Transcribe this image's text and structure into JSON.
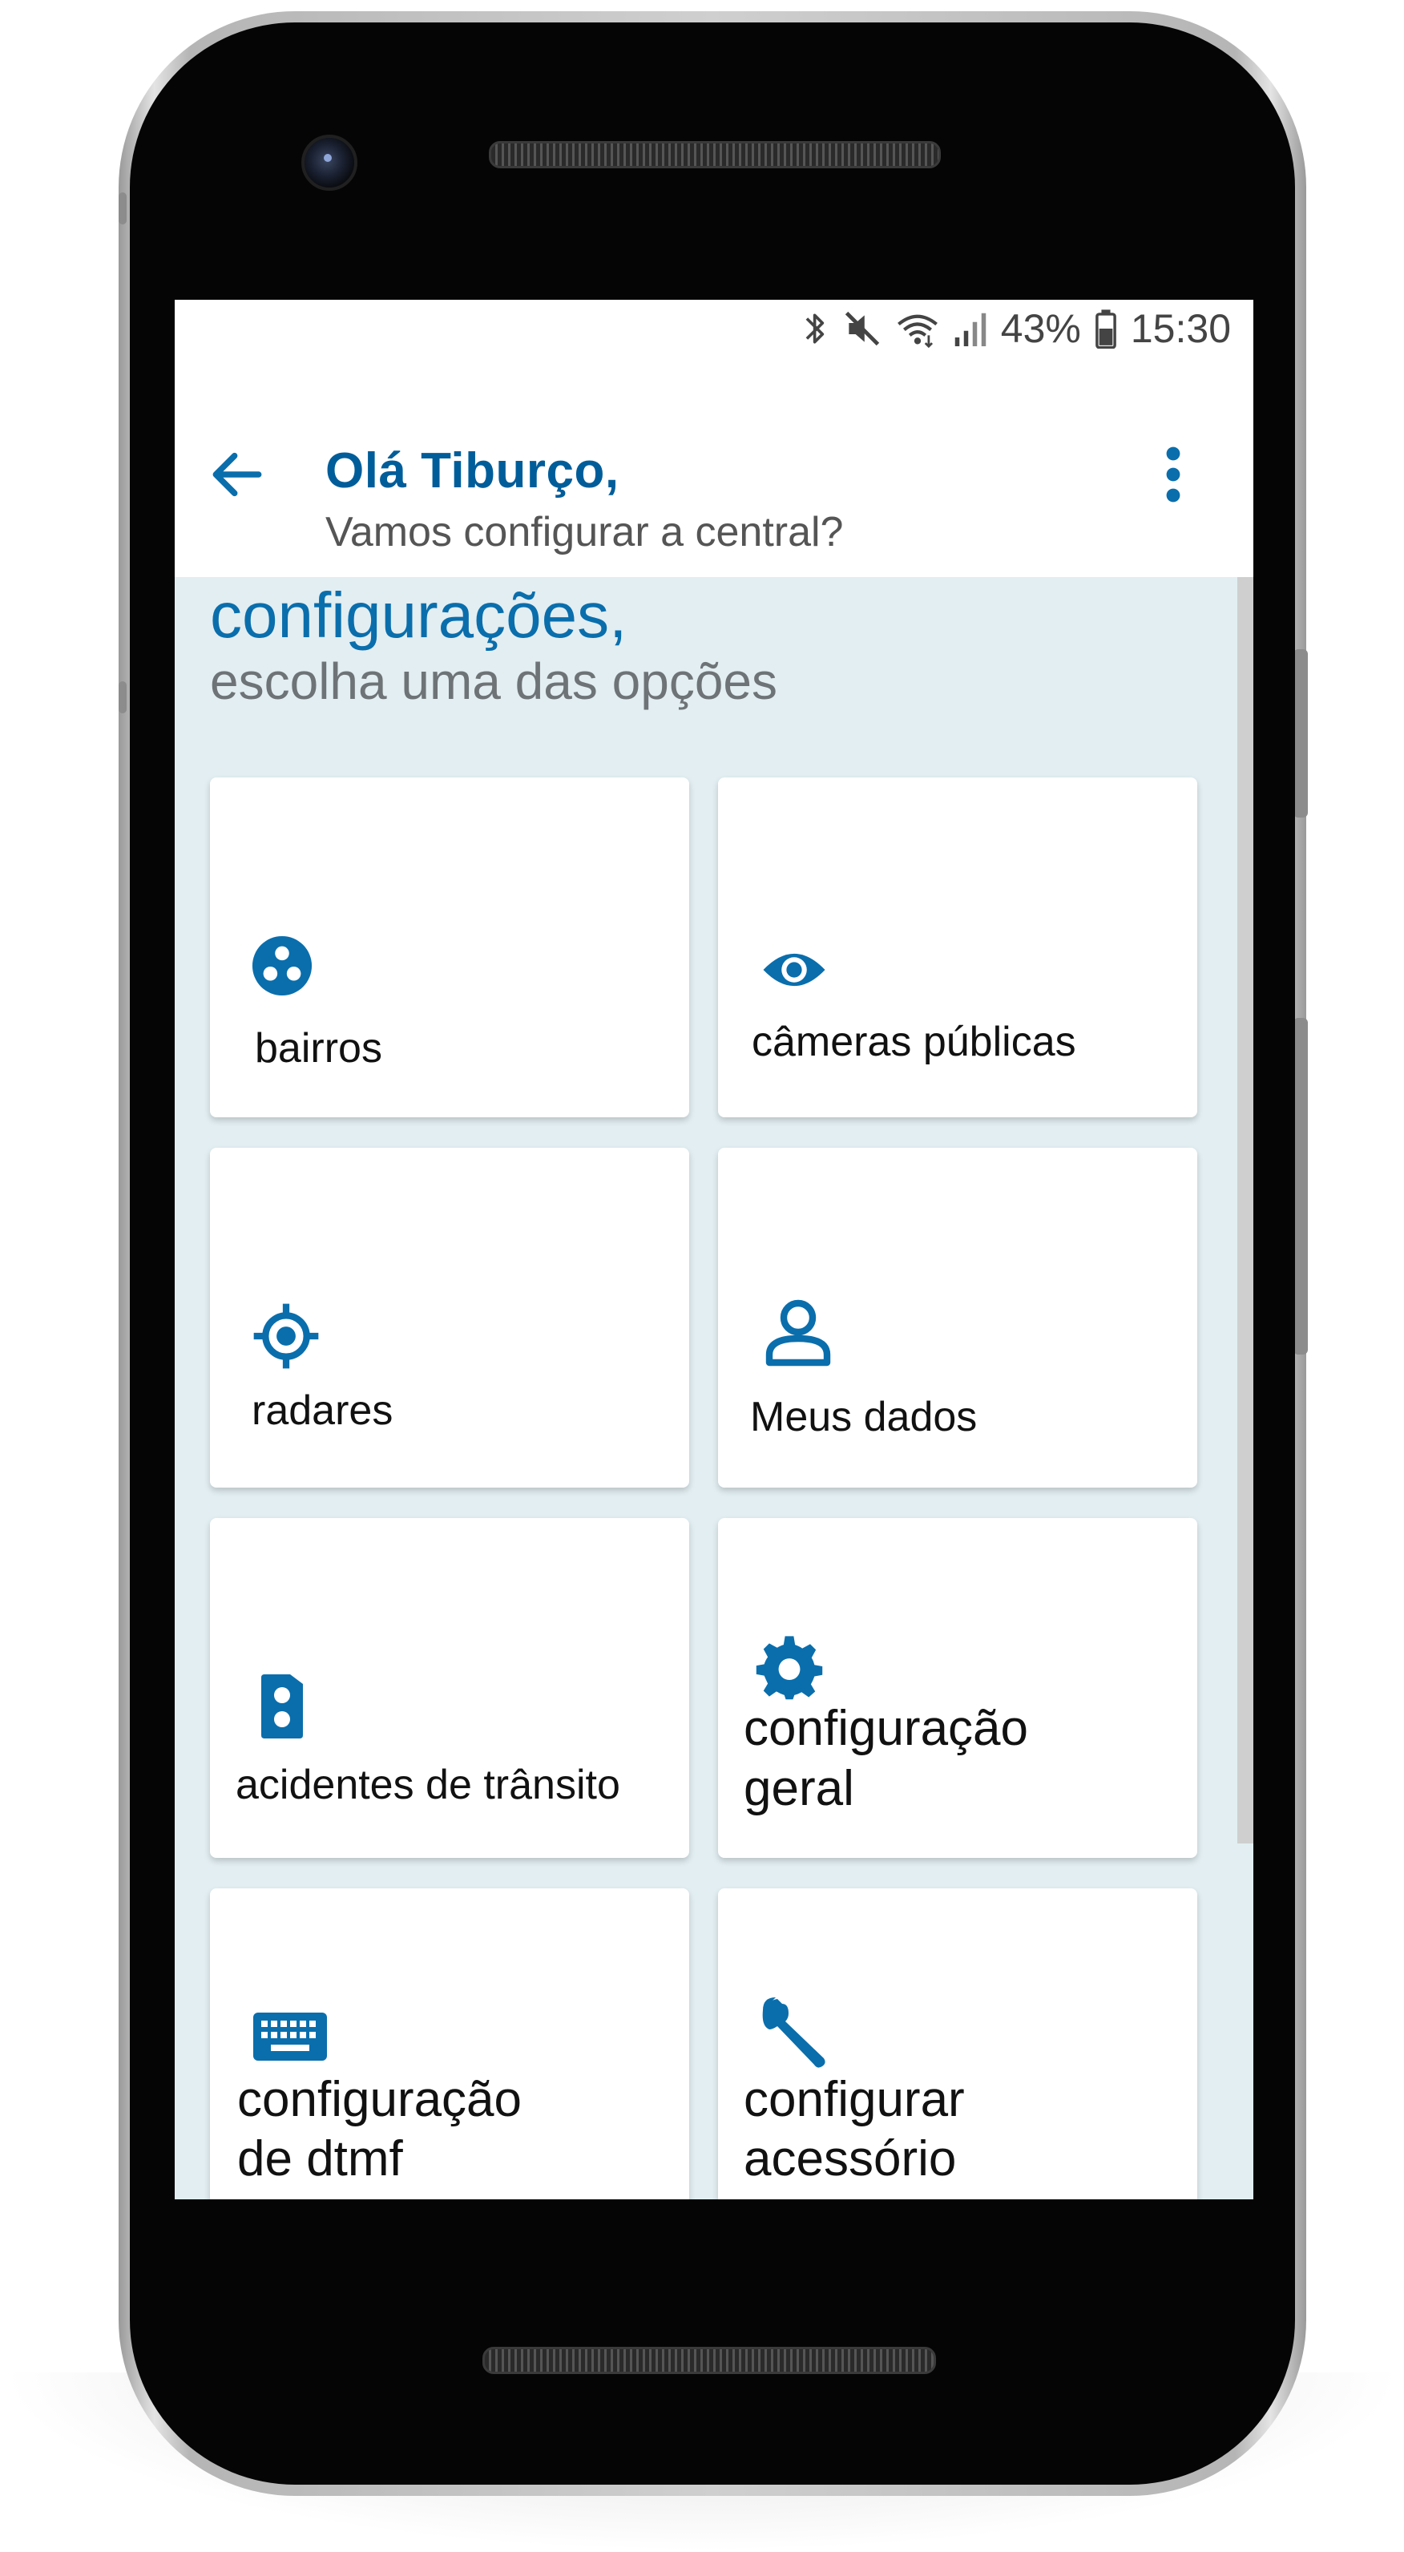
{
  "status_bar": {
    "battery": "43%",
    "time": "15:30",
    "icons": [
      "bluetooth-icon",
      "mute-icon",
      "wifi-icon",
      "signal-icon",
      "battery-icon"
    ]
  },
  "header": {
    "greeting": "Olá Tiburço,",
    "subtitle": "Vamos configurar a central?"
  },
  "section": {
    "title": "configurações,",
    "subtitle": "escolha uma das opções"
  },
  "tiles": [
    {
      "label": "bairros",
      "icon": "neighborhoods-icon"
    },
    {
      "label": "câmeras públicas",
      "icon": "eye-icon"
    },
    {
      "label": "radares",
      "icon": "target-icon"
    },
    {
      "label": "Meus dados",
      "icon": "person-icon"
    },
    {
      "label": "acidentes de trânsito",
      "icon": "traffic-light-icon"
    },
    {
      "label_line1": "configuração",
      "label_line2": "geral",
      "icon": "gear-icon"
    },
    {
      "label_line1": "configuração",
      "label_line2": "de dtmf",
      "icon": "keyboard-icon"
    },
    {
      "label_line1": "configurar",
      "label_line2": "acessório",
      "icon": "wrench-icon"
    }
  ],
  "colors": {
    "accent": "#005d99",
    "background": "#e2eef2",
    "tile": "#ffffff"
  }
}
